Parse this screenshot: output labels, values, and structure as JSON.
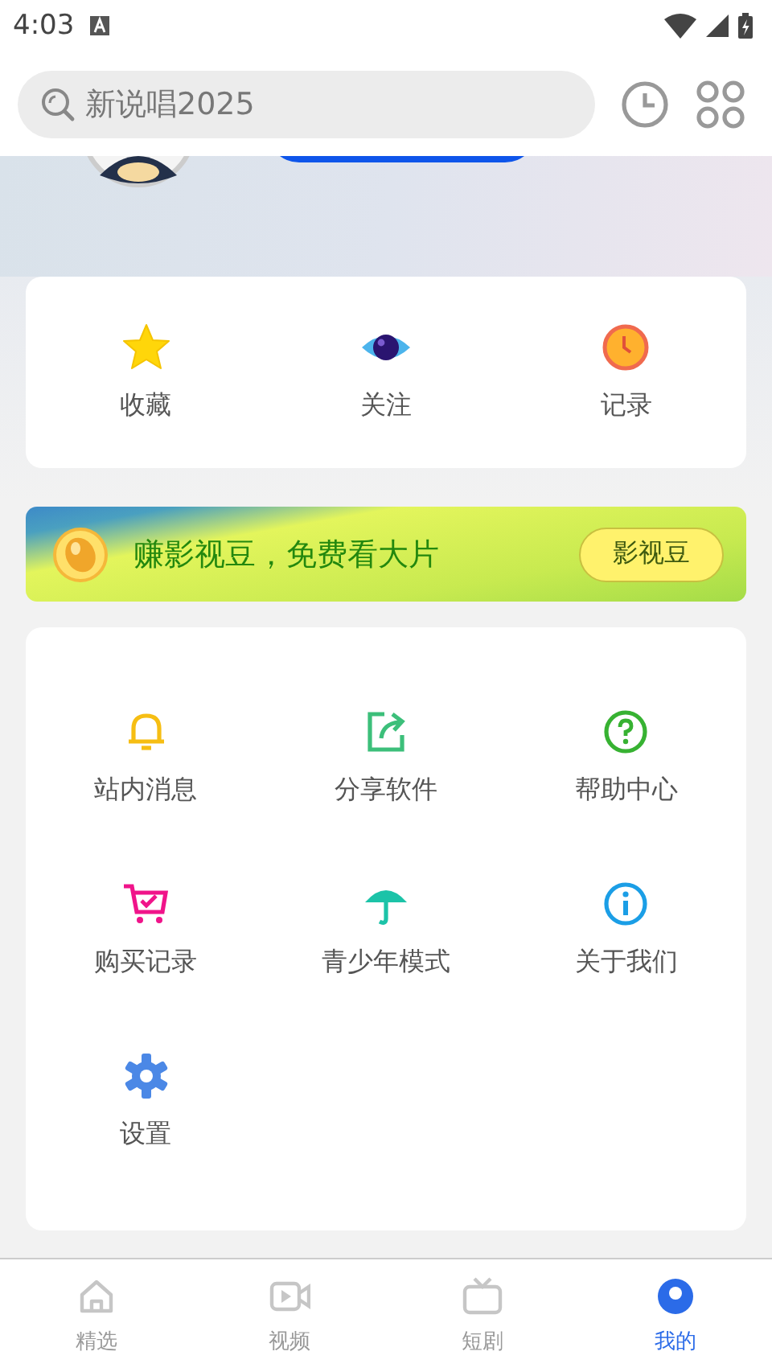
{
  "status_bar": {
    "time": "4:03"
  },
  "search": {
    "value": "新说唱2025"
  },
  "quick_actions": [
    {
      "kind": "star",
      "label": "收藏"
    },
    {
      "kind": "eye",
      "label": "关注"
    },
    {
      "kind": "clock",
      "label": "记录"
    }
  ],
  "banner": {
    "text": "赚影视豆，免费看大片",
    "button": "影视豆"
  },
  "menu": [
    {
      "kind": "bell",
      "label": "站内消息"
    },
    {
      "kind": "share",
      "label": "分享软件"
    },
    {
      "kind": "help",
      "label": "帮助中心"
    },
    {
      "kind": "cart",
      "label": "购买记录"
    },
    {
      "kind": "umbrella",
      "label": "青少年模式"
    },
    {
      "kind": "info",
      "label": "关于我们"
    },
    {
      "kind": "gear",
      "label": "设置"
    }
  ],
  "tabs": [
    {
      "kind": "home",
      "label": "精选",
      "selected": false
    },
    {
      "kind": "video",
      "label": "视频",
      "selected": false
    },
    {
      "kind": "tv",
      "label": "短剧",
      "selected": false
    },
    {
      "kind": "me",
      "label": "我的",
      "selected": true
    }
  ]
}
